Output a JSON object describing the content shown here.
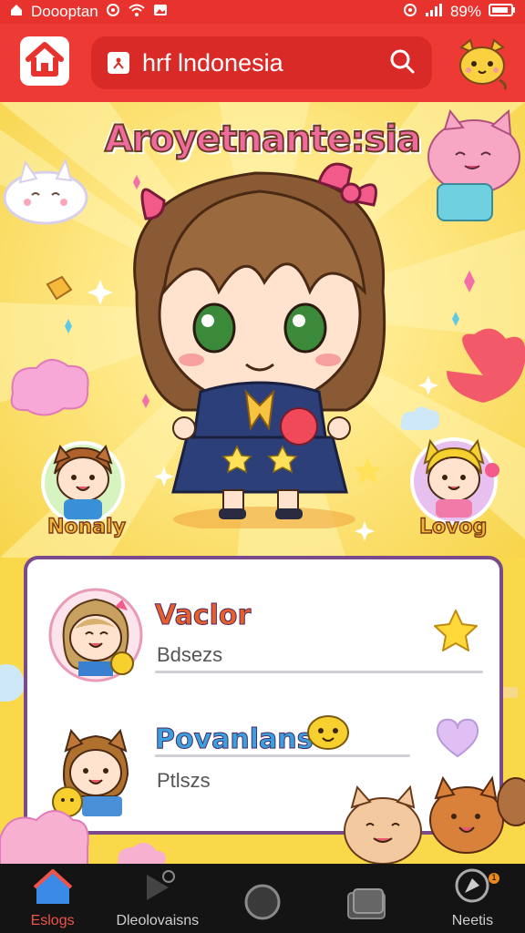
{
  "status_bar": {
    "carrier": "Doooptan",
    "battery": "89%"
  },
  "header": {
    "search_text": "hrf lndonesia",
    "search_icon": "search-icon",
    "home_icon": "home-icon"
  },
  "hero": {
    "title": "Aroyetnante:sia",
    "left_label": "Nonaly",
    "right_label": "Lovog"
  },
  "list": {
    "items": [
      {
        "name": "Vaclor",
        "subtitle": "Bdsezs",
        "color": "#e85f2a"
      },
      {
        "name": "Povanlans",
        "subtitle": "Ptlszs",
        "color": "#3aa0e0"
      }
    ]
  },
  "nav": {
    "items": [
      {
        "label": "Eslogs",
        "icon": "home-icon"
      },
      {
        "label": "Dleolovaisns",
        "icon": "play-icon"
      },
      {
        "label": "",
        "icon": "record-icon"
      },
      {
        "label": "",
        "icon": "cards-icon"
      },
      {
        "label": "Neetis",
        "icon": "compass-icon"
      }
    ]
  },
  "colors": {
    "header_red": "#ee3a34",
    "hero_yellow": "#f9d94a",
    "nav_black": "#141414",
    "active_red": "#f05448"
  }
}
